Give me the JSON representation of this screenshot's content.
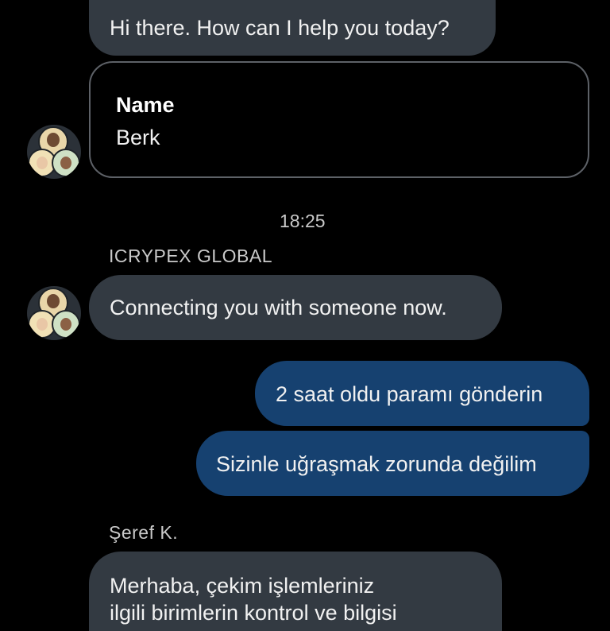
{
  "messages": {
    "greeting": "Hi there. How can I help you today?",
    "card": {
      "label": "Name",
      "value": "Berk"
    },
    "timestamp": "18:25",
    "sender_bot": "ICRYPEX GLOBAL",
    "connecting": "Connecting you with someone now.",
    "user_1": "2 saat oldu paramı gönderin",
    "user_2": "Sizinle uğraşmak zorunda değilim",
    "sender_agent": "Şeref K.",
    "agent_line_1": "Merhaba, çekim işlemleriniz",
    "agent_line_2": "ilgili birimlerin kontrol ve bilgisi"
  },
  "icons": [
    "agent-group-avatar-icon"
  ],
  "colors": {
    "background": "#000000",
    "incoming_bubble": "#333a42",
    "outgoing_bubble": "#164170",
    "card_border": "#5d6167"
  }
}
